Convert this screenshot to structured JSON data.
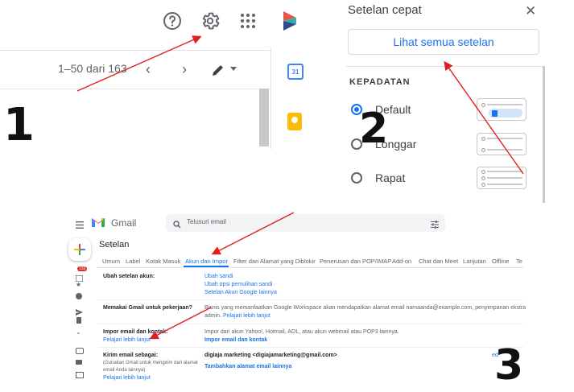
{
  "panel1": {
    "pager_text": "1–50 dari 163",
    "icons": [
      "help-icon",
      "settings-gear-icon",
      "apps-grid-icon",
      "account-logo-icon",
      "chevron-left-icon",
      "chevron-right-icon",
      "pencil-icon",
      "caret-down-icon"
    ],
    "step_number": "1"
  },
  "side_strip": {
    "calendar_day": "31",
    "icons": [
      "calendar-icon",
      "keep-icon"
    ]
  },
  "quick_settings": {
    "title": "Setelan cepat",
    "close_glyph": "✕",
    "see_all_button": "Lihat semua setelan",
    "density_heading": "KEPADATAN",
    "options": [
      {
        "label": "Default",
        "selected": true
      },
      {
        "label": "Longgar",
        "selected": false
      },
      {
        "label": "Rapat",
        "selected": false
      }
    ],
    "step_number": "2"
  },
  "gmail_settings": {
    "app_name": "Gmail",
    "search_placeholder": "Telusuri email",
    "unread_badge": "133",
    "page_title": "Setelan",
    "tabs": [
      "Umum",
      "Label",
      "Kotak Masuk",
      "Akun dan Impor",
      "Filter dan Alamat yang Diblokir",
      "Penerusan dan POP/IMAP",
      "Add-on",
      "Chat dan Meet",
      "Lanjutan",
      "Offline",
      "Te"
    ],
    "active_tab": "Akun dan Impor",
    "sections": {
      "change_account": {
        "heading": "Ubah setelan akun:",
        "links": [
          "Ubah sandi",
          "Ubah opsi pemulihan sandi",
          "Setelan Akun Google lainnya"
        ]
      },
      "work": {
        "heading": "Memakai Gmail untuk pekerjaan?",
        "text_1": "Bisnis yang memanfaatkan Google Workspace akan mendapatkan alamat email namaanda@example.com, penyimpanan ekstra",
        "text_2": "admin.",
        "link": "Pelajari lebih lanjut"
      },
      "import": {
        "heading": "Impor email dan kontak:",
        "learn_more": "Pelajari lebih lanjut",
        "text": "Impor dari akun Yahoo!, Hotmail, AOL, atau akun webmail atau POP3 lainnya.",
        "action": "Impor email dan kontak"
      },
      "send_as": {
        "heading": "Kirim email sebagai:",
        "sub_1": "(Gunakan Gmail untuk mengirim dari alamat",
        "sub_2": "email Anda lainnya)",
        "learn_more": "Pelajari lebih lanjut",
        "account": "digiaja marketing <digiajamarketing@gmail.com>",
        "add_link": "Tambahkan alamat email lainnya",
        "edit_fragment": "ed"
      }
    },
    "step_number": "3"
  },
  "colors": {
    "annotation_arrow": "#e02020",
    "accent_blue": "#1a73e8",
    "badge_red": "#d93025"
  }
}
